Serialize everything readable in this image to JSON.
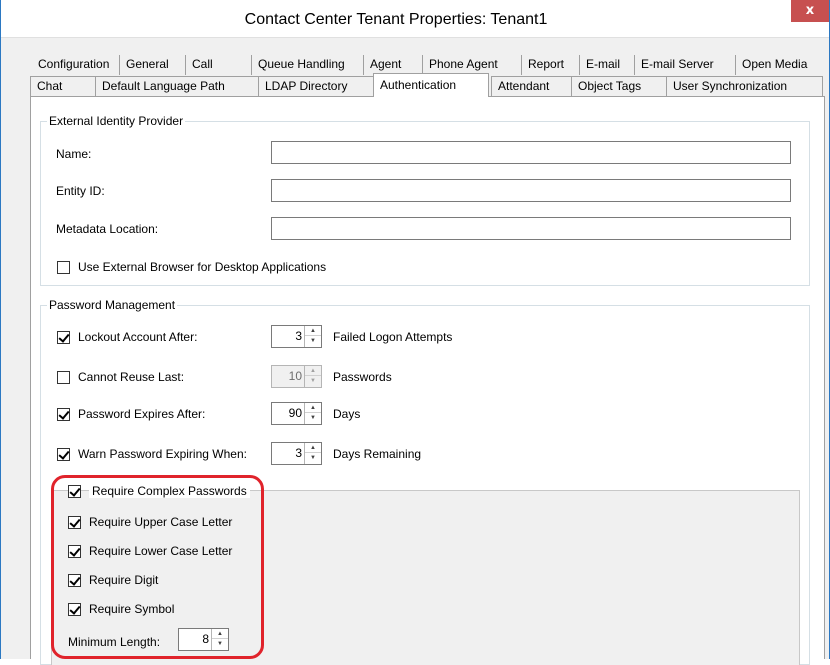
{
  "window": {
    "title": "Contact Center Tenant Properties: Tenant1",
    "close_label": "x"
  },
  "tabs": {
    "row1": [
      "Configuration",
      "General",
      "Call",
      "Queue Handling",
      "Agent",
      "Phone Agent",
      "Report",
      "E-mail",
      "E-mail Server",
      "Open Media"
    ],
    "row2": [
      "Chat",
      "Default Language Path",
      "LDAP Directory",
      "Authentication",
      "Attendant",
      "Object Tags",
      "User Synchronization"
    ],
    "active": "Authentication"
  },
  "external_idp": {
    "legend": "External Identity Provider",
    "name_label": "Name:",
    "name_value": "",
    "entity_id_label": "Entity ID:",
    "entity_id_value": "",
    "metadata_label": "Metadata Location:",
    "metadata_value": "",
    "external_browser_label": "Use External Browser for Desktop Applications",
    "external_browser_checked": false
  },
  "password_mgmt": {
    "legend": "Password Management",
    "lockout_label": "Lockout Account After:",
    "lockout_checked": true,
    "lockout_value": "3",
    "lockout_suffix": "Failed Logon Attempts",
    "reuse_label": "Cannot Reuse Last:",
    "reuse_checked": false,
    "reuse_value": "10",
    "reuse_suffix": "Passwords",
    "expires_label": "Password Expires After:",
    "expires_checked": true,
    "expires_value": "90",
    "expires_suffix": "Days",
    "warn_label": "Warn Password Expiring When:",
    "warn_checked": true,
    "warn_value": "3",
    "warn_suffix": "Days Remaining"
  },
  "complex": {
    "legend": "Require Complex Passwords",
    "legend_checked": true,
    "upper_label": "Require Upper Case Letter",
    "upper_checked": true,
    "lower_label": "Require Lower Case Letter",
    "lower_checked": true,
    "digit_label": "Require Digit",
    "digit_checked": true,
    "symbol_label": "Require Symbol",
    "symbol_checked": true,
    "min_length_label": "Minimum Length:",
    "min_length_value": "8"
  },
  "colors": {
    "highlight": "#e0232b",
    "close_button": "#c75050",
    "window_border": "#2b78c2"
  },
  "icons": {
    "close": "close-icon",
    "spin_up": "spin-up-icon",
    "spin_down": "spin-down-icon",
    "check": "checkmark-icon"
  }
}
